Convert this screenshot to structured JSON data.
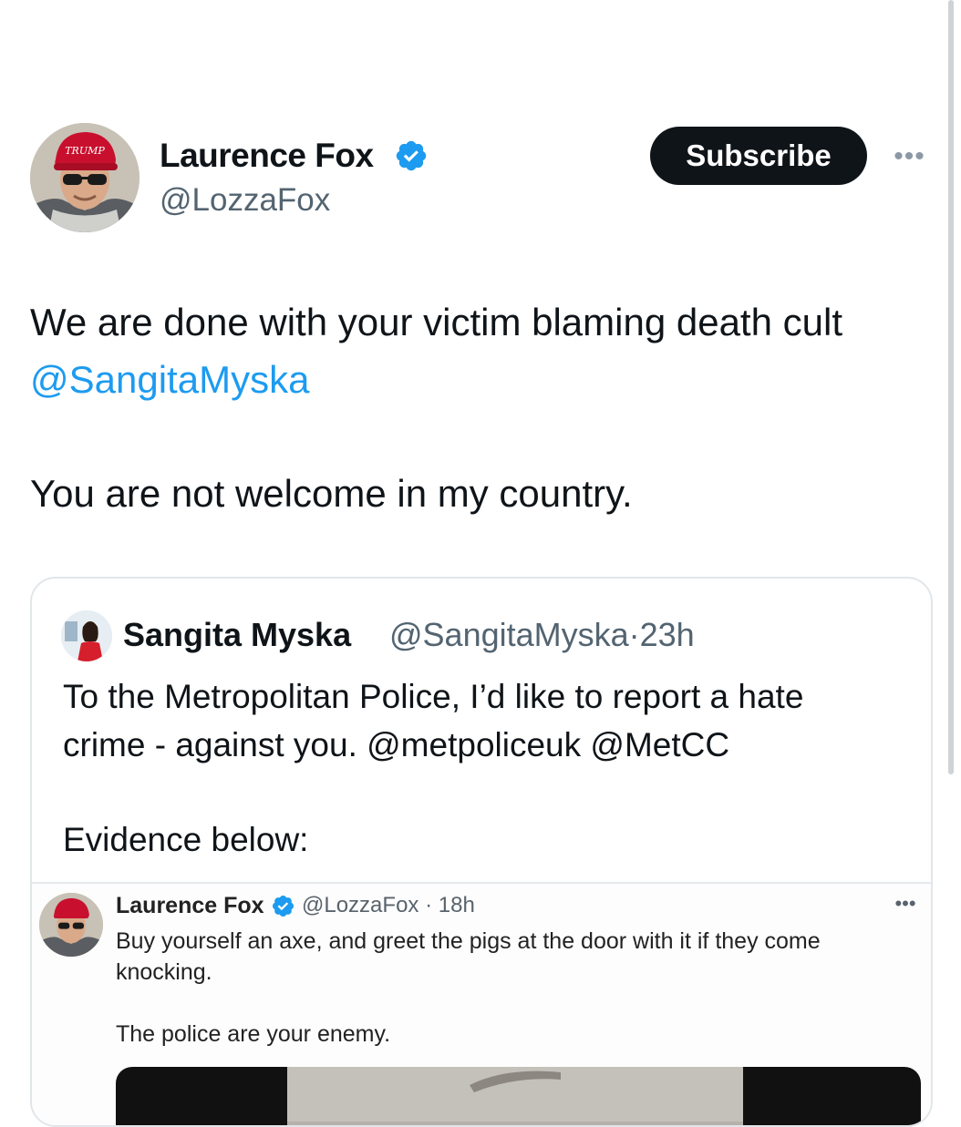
{
  "tweet": {
    "display_name": "Laurence Fox",
    "handle": "@LozzaFox",
    "subscribe_label": "Subscribe",
    "more_label": "•••",
    "text_line1": "We are done with your victim blaming death cult",
    "mention": "@SangitaMyska",
    "text_line2": "You are not welcome in my country."
  },
  "quote": {
    "display_name": "Sangita Myska",
    "handle_time": "@SangitaMyska·23h",
    "text_line1": "To the Metropolitan Police, I’d like to report a hate",
    "text_line2": "crime - against you.  @metpoliceuk @MetCC",
    "text_line3": "Evidence below:"
  },
  "embedded": {
    "display_name": "Laurence Fox",
    "handle_time": "@LozzaFox · 18h",
    "more_label": "•••",
    "text_line1": "Buy yourself an axe, and greet the pigs at the door with it if they come knocking.",
    "text_line2": "The police are your enemy.",
    "avatar_cap_text": "Trump"
  },
  "colors": {
    "accent": "#1d9bf0",
    "text": "#0f1419",
    "muted": "#536471",
    "button_bg": "#0f1419"
  },
  "icons": [
    "verified-badge-icon",
    "more-icon"
  ]
}
